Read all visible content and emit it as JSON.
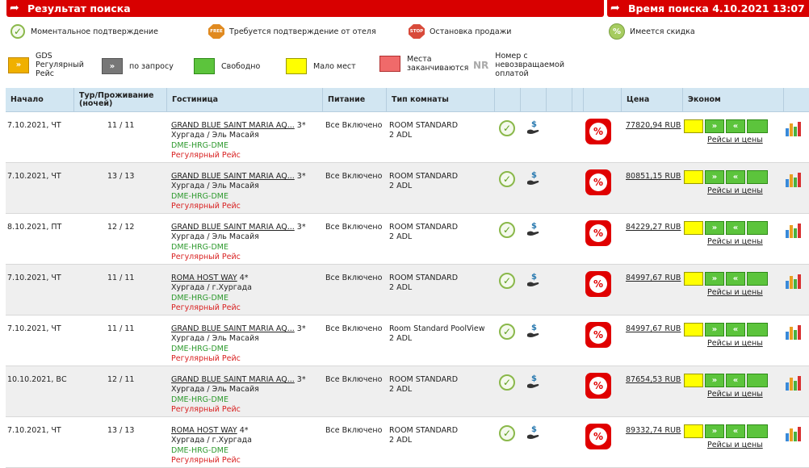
{
  "header": {
    "left_title": "Результат поиска",
    "right_title": "Время поиска 4.10.2021 13:07"
  },
  "legend": {
    "instant": "Моментальное подтверждение",
    "hotel_confirm": "Требуется подтверждение от отеля",
    "hotel_confirm_icon_text": "FREE",
    "stop_sale": "Остановка продажи",
    "stop_icon_text": "STOP",
    "discount": "Имеется скидка",
    "discount_icon_text": "%",
    "gds": "GDS Регулярный Рейс",
    "on_request": "по запросу",
    "free": "Свободно",
    "few": "Мало мест",
    "running_out": "Места заканчиваются",
    "nr_abbr": "NR",
    "nr": "Номер с невозвращаемой оплатой"
  },
  "colors": {
    "header_red": "#d80000",
    "available_green": "#5cc43c",
    "few_yellow": "#ffff00",
    "running_out_red": "#f06a6a",
    "gds_orange": "#f0b000",
    "route_green": "#2f9a2f",
    "flight_red": "#d82020"
  },
  "table": {
    "columns": {
      "start": "Начало",
      "nights": "Тур/Проживание (ночей)",
      "hotel": "Гостиница",
      "meal": "Питание",
      "room": "Тип комнаты",
      "price": "Цена",
      "econom": "Эконом"
    },
    "rows": [
      {
        "date": "7.10.2021, ЧТ",
        "nights": "11 / 11",
        "hotel": "GRAND BLUE SAINT MARIA AQ...",
        "stars": "3*",
        "location": "Хургада / Эль Масайя",
        "route": "DME-HRG-DME",
        "flight": "Регулярный Рейс",
        "meal": "Все Включено",
        "room": "ROOM STANDARD",
        "pax": "2 ADL",
        "price": "77820,94 RUB",
        "flights_link": "Рейсы и цены"
      },
      {
        "date": "7.10.2021, ЧТ",
        "nights": "13 / 13",
        "hotel": "GRAND BLUE SAINT MARIA AQ...",
        "stars": "3*",
        "location": "Хургада / Эль Масайя",
        "route": "DME-HRG-DME",
        "flight": "Регулярный Рейс",
        "meal": "Все Включено",
        "room": "ROOM STANDARD",
        "pax": "2 ADL",
        "price": "80851,15 RUB",
        "flights_link": "Рейсы и цены"
      },
      {
        "date": "8.10.2021, ПТ",
        "nights": "12 / 12",
        "hotel": "GRAND BLUE SAINT MARIA AQ...",
        "stars": "3*",
        "location": "Хургада / Эль Масайя",
        "route": "DME-HRG-DME",
        "flight": "Регулярный Рейс",
        "meal": "Все Включено",
        "room": "ROOM STANDARD",
        "pax": "2 ADL",
        "price": "84229,27 RUB",
        "flights_link": "Рейсы и цены"
      },
      {
        "date": "7.10.2021, ЧТ",
        "nights": "11 / 11",
        "hotel": "ROMA HOST WAY",
        "stars": "4*",
        "location": "Хургада / г.Хургада",
        "route": "DME-HRG-DME",
        "flight": "Регулярный Рейс",
        "meal": "Все Включено",
        "room": "ROOM STANDARD",
        "pax": "2 ADL",
        "price": "84997,67 RUB",
        "flights_link": "Рейсы и цены"
      },
      {
        "date": "7.10.2021, ЧТ",
        "nights": "11 / 11",
        "hotel": "GRAND BLUE SAINT MARIA AQ...",
        "stars": "3*",
        "location": "Хургада / Эль Масайя",
        "route": "DME-HRG-DME",
        "flight": "Регулярный Рейс",
        "meal": "Все Включено",
        "room": "Room Standard PoolView",
        "pax": "2 ADL",
        "price": "84997,67 RUB",
        "flights_link": "Рейсы и цены"
      },
      {
        "date": "10.10.2021, ВС",
        "nights": "12 / 11",
        "hotel": "GRAND BLUE SAINT MARIA AQ...",
        "stars": "3*",
        "location": "Хургада / Эль Масайя",
        "route": "DME-HRG-DME",
        "flight": "Регулярный Рейс",
        "meal": "Все Включено",
        "room": "ROOM STANDARD",
        "pax": "2 ADL",
        "price": "87654,53 RUB",
        "flights_link": "Рейсы и цены"
      },
      {
        "date": "7.10.2021, ЧТ",
        "nights": "13 / 13",
        "hotel": "ROMA HOST WAY",
        "stars": "4*",
        "location": "Хургада / г.Хургада",
        "route": "DME-HRG-DME",
        "flight": "Регулярный Рейс",
        "meal": "Все Включено",
        "room": "ROOM STANDARD",
        "pax": "2 ADL",
        "price": "89332,74 RUB",
        "flights_link": "Рейсы и цены"
      }
    ]
  }
}
